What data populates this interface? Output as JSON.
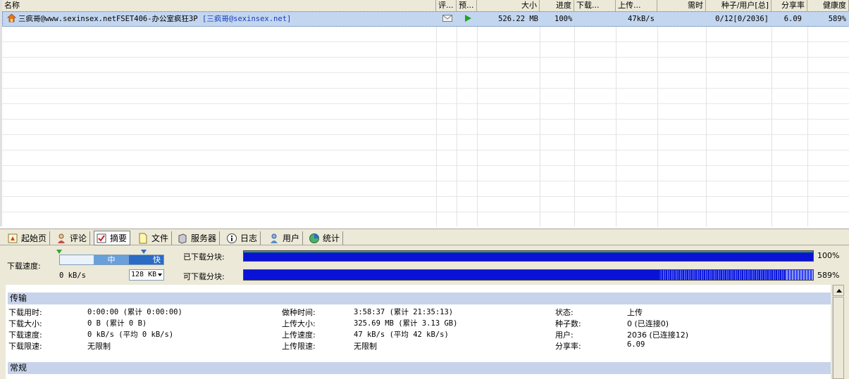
{
  "columns": [
    {
      "label": "名称"
    },
    {
      "label": "评..."
    },
    {
      "label": "预..."
    },
    {
      "label": "大小"
    },
    {
      "label": "进度"
    },
    {
      "label": "下载..."
    },
    {
      "label": "上传..."
    },
    {
      "label": "需时"
    },
    {
      "label": "种子/用户[总]"
    },
    {
      "label": "分享率"
    },
    {
      "label": "健康度"
    }
  ],
  "torrent": {
    "name": "三疯哥@www.sexinsex.netFSET406-办公室疯狂3P",
    "tag": "[三疯哥@sexinsex.net]",
    "size": "526.22 MB",
    "progress": "100%",
    "download": "",
    "upload": "47kB/s",
    "eta": "",
    "seeds_peers": "0/12[0/2036]",
    "ratio": "6.09",
    "health": "589%"
  },
  "tabs": [
    {
      "label": "起始页",
      "icon": "home-page-icon"
    },
    {
      "label": "评论",
      "icon": "comment-icon"
    },
    {
      "label": "摘要",
      "icon": "summary-check-icon"
    },
    {
      "label": "文件",
      "icon": "file-icon"
    },
    {
      "label": "服务器",
      "icon": "server-icon"
    },
    {
      "label": "日志",
      "icon": "info-log-icon"
    },
    {
      "label": "用户",
      "icon": "user-icon"
    },
    {
      "label": "统计",
      "icon": "stats-icon"
    }
  ],
  "summary": {
    "download_speed_label": "下载速度:",
    "slider_mid": "中",
    "slider_fast": "快",
    "current_speed": "0 kB/s",
    "limit_value": "128 KB",
    "downloaded_pieces_label": "已下载分块:",
    "downloaded_pieces_pct": "100%",
    "downloaded_pieces_fraction": 1.0,
    "available_pieces_label": "可下载分块:",
    "available_pieces_pct": "589%"
  },
  "transfer": {
    "title": "传输",
    "rows": [
      {
        "k1": "下载用时:",
        "v1": "0:00:00 (累计 0:00:00)",
        "k2": "做种时间:",
        "v2": "3:58:37 (累计 21:35:13)",
        "k3": "状态:",
        "v3": "上传"
      },
      {
        "k1": "下载大小:",
        "v1": "0 B (累计 0 B)",
        "k2": "上传大小:",
        "v2": "325.69 MB (累计 3.13 GB)",
        "k3": "种子数:",
        "v3": "0 (已连接0)"
      },
      {
        "k1": "下载速度:",
        "v1": "0 kB/s (平均 0 kB/s)",
        "k2": "上传速度:",
        "v2": "47 kB/s (平均 42 kB/s)",
        "k3": "用户:",
        "v3": "2036 (已连接12)"
      },
      {
        "k1": "下载限速:",
        "v1": "无限制",
        "k2": "上传限速:",
        "v2": "无限制",
        "k3": "分享率:",
        "v3": "6.09"
      }
    ]
  },
  "general": {
    "title": "常规"
  },
  "colors": {
    "selected_row": "#c3d6ef",
    "piece_bar": "#0a12d8",
    "section_head": "#c7d3ea",
    "chrome": "#ece9d8"
  }
}
